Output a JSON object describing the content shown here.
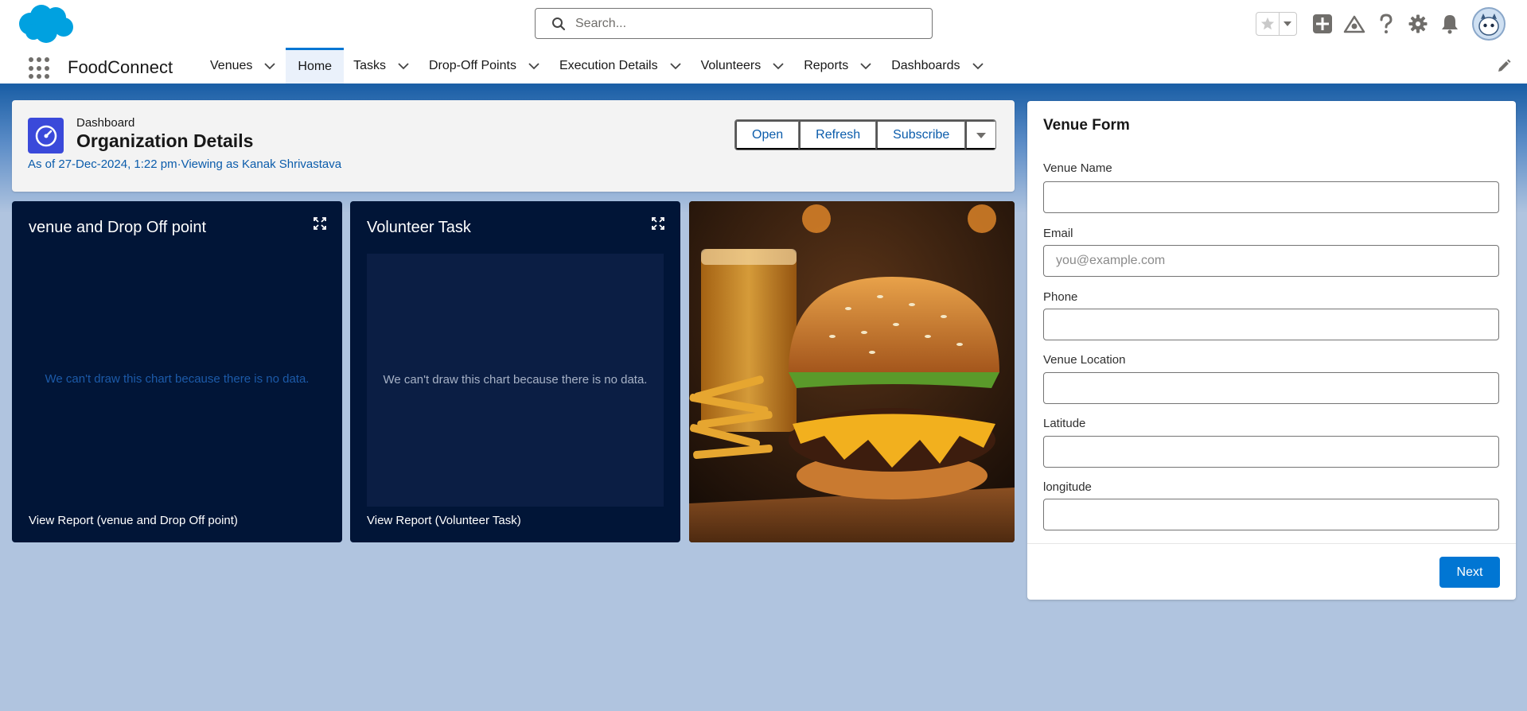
{
  "header": {
    "search_placeholder": "Search..."
  },
  "nav": {
    "app_name": "FoodConnect",
    "items": [
      {
        "label": "Venues"
      },
      {
        "label": "Home"
      },
      {
        "label": "Tasks"
      },
      {
        "label": "Drop-Off Points"
      },
      {
        "label": "Execution Details"
      },
      {
        "label": "Volunteers"
      },
      {
        "label": "Reports"
      },
      {
        "label": "Dashboards"
      }
    ],
    "active": "Home"
  },
  "dashboard": {
    "type_label": "Dashboard",
    "title": "Organization Details",
    "subtitle": "As of 27-Dec-2024, 1:22 pm·Viewing as Kanak Shrivastava",
    "buttons": {
      "open": "Open",
      "refresh": "Refresh",
      "subscribe": "Subscribe"
    }
  },
  "cards": [
    {
      "title": "venue and Drop Off point",
      "no_data": "We can't draw this chart because there is no data.",
      "view_report": "View Report (venue and Drop Off point)"
    },
    {
      "title": "Volunteer Task",
      "no_data": "We can't draw this chart because there is no data.",
      "view_report": "View Report (Volunteer Task)"
    }
  ],
  "form": {
    "title": "Venue Form",
    "fields": [
      {
        "label": "Venue Name",
        "value": "",
        "placeholder": ""
      },
      {
        "label": "Email",
        "value": "",
        "placeholder": "you@example.com"
      },
      {
        "label": "Phone",
        "value": "",
        "placeholder": ""
      },
      {
        "label": "Venue Location",
        "value": "",
        "placeholder": ""
      },
      {
        "label": "Latitude",
        "value": "",
        "placeholder": ""
      },
      {
        "label": "longitude",
        "value": "",
        "placeholder": ""
      }
    ],
    "next_label": "Next"
  },
  "colors": {
    "brand": "#0176d3",
    "nav_accent": "#1b5fa6",
    "card_bg": "#011537",
    "dashboard_icon": "#3a49da"
  },
  "icons": [
    "salesforce-cloud-logo",
    "search-icon",
    "star-icon",
    "chevron-down-icon",
    "add-icon",
    "trailhead-icon",
    "help-icon",
    "gear-icon",
    "bell-icon",
    "avatar",
    "app-launcher-icon",
    "edit-pencil-icon",
    "dashboard-gauge-icon",
    "expand-icon"
  ]
}
